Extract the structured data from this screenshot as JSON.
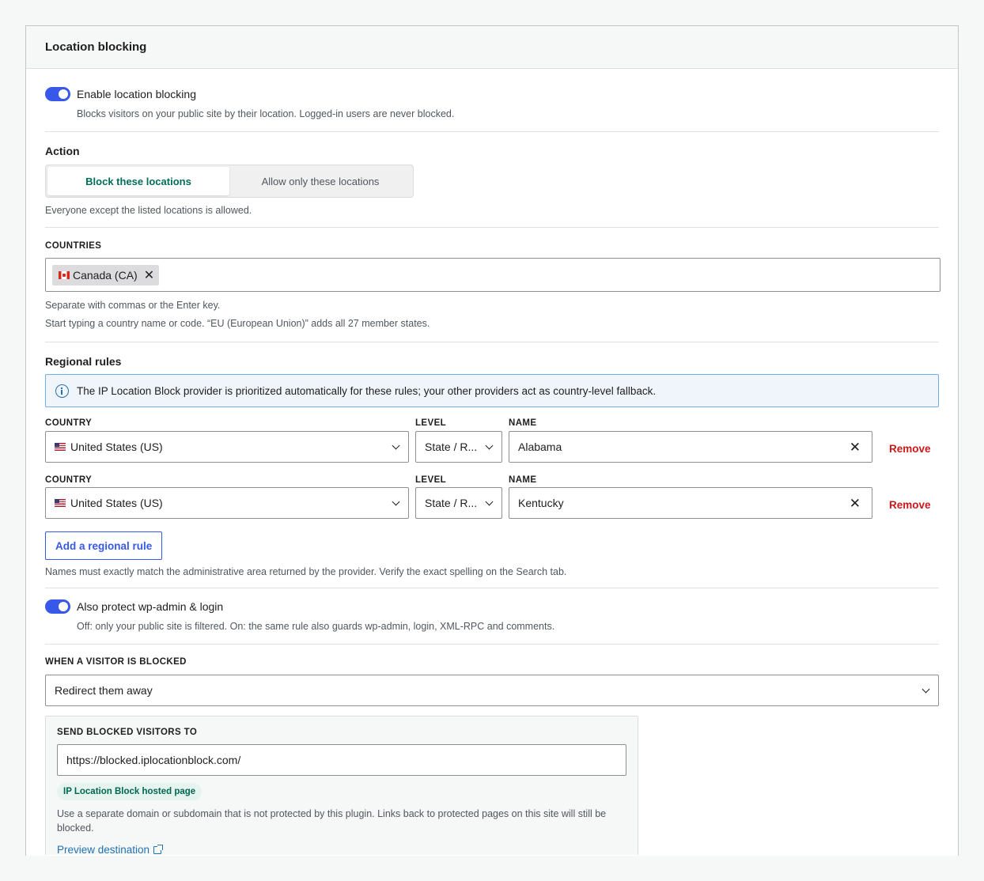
{
  "panel": {
    "title": "Location blocking"
  },
  "enable": {
    "label": "Enable location blocking",
    "help": "Blocks visitors on your public site by their location. Logged-in users are never blocked."
  },
  "action": {
    "heading": "Action",
    "options": [
      "Block these locations",
      "Allow only these locations"
    ],
    "selected": "Block these locations",
    "help": "Everyone except the listed locations is allowed."
  },
  "countries": {
    "heading": "COUNTRIES",
    "tokens": [
      {
        "label": "Canada (CA)",
        "flag": "flag-ca-icon"
      }
    ],
    "help1": "Separate with commas or the Enter key.",
    "help2": "Start typing a country name or code. “EU (European Union)” adds all 27 member states."
  },
  "regional": {
    "heading": "Regional rules",
    "notice": "The IP Location Block provider is prioritized automatically for these rules; your other providers act as country-level fallback.",
    "labels": {
      "country": "COUNTRY",
      "level": "LEVEL",
      "name": "NAME"
    },
    "rules": [
      {
        "country": "United States (US)",
        "level": "State / R...",
        "name": "Alabama",
        "remove": "Remove"
      },
      {
        "country": "United States (US)",
        "level": "State / R...",
        "name": "Kentucky",
        "remove": "Remove"
      }
    ],
    "add_button": "Add a regional rule",
    "help": "Names must exactly match the administrative area returned by the provider. Verify the exact spelling on the Search tab."
  },
  "protect": {
    "label": "Also protect wp-admin & login",
    "help": "Off: only your public site is filtered. On: the same rule also guards wp-admin, login, XML-RPC and comments."
  },
  "blocked": {
    "heading": "WHEN A VISITOR IS BLOCKED",
    "selected": "Redirect them away"
  },
  "redirect": {
    "heading": "SEND BLOCKED VISITORS TO",
    "url": "https://blocked.iplocationblock.com/",
    "badge": "IP Location Block hosted page",
    "help": "Use a separate domain or subdomain that is not protected by this plugin. Links back to protected pages on this site will still be blocked.",
    "preview": "Preview destination"
  },
  "colors": {
    "accent": "#3858e9",
    "active_segment": "#006d5b",
    "remove": "#cc1818",
    "link": "#2271b1"
  }
}
